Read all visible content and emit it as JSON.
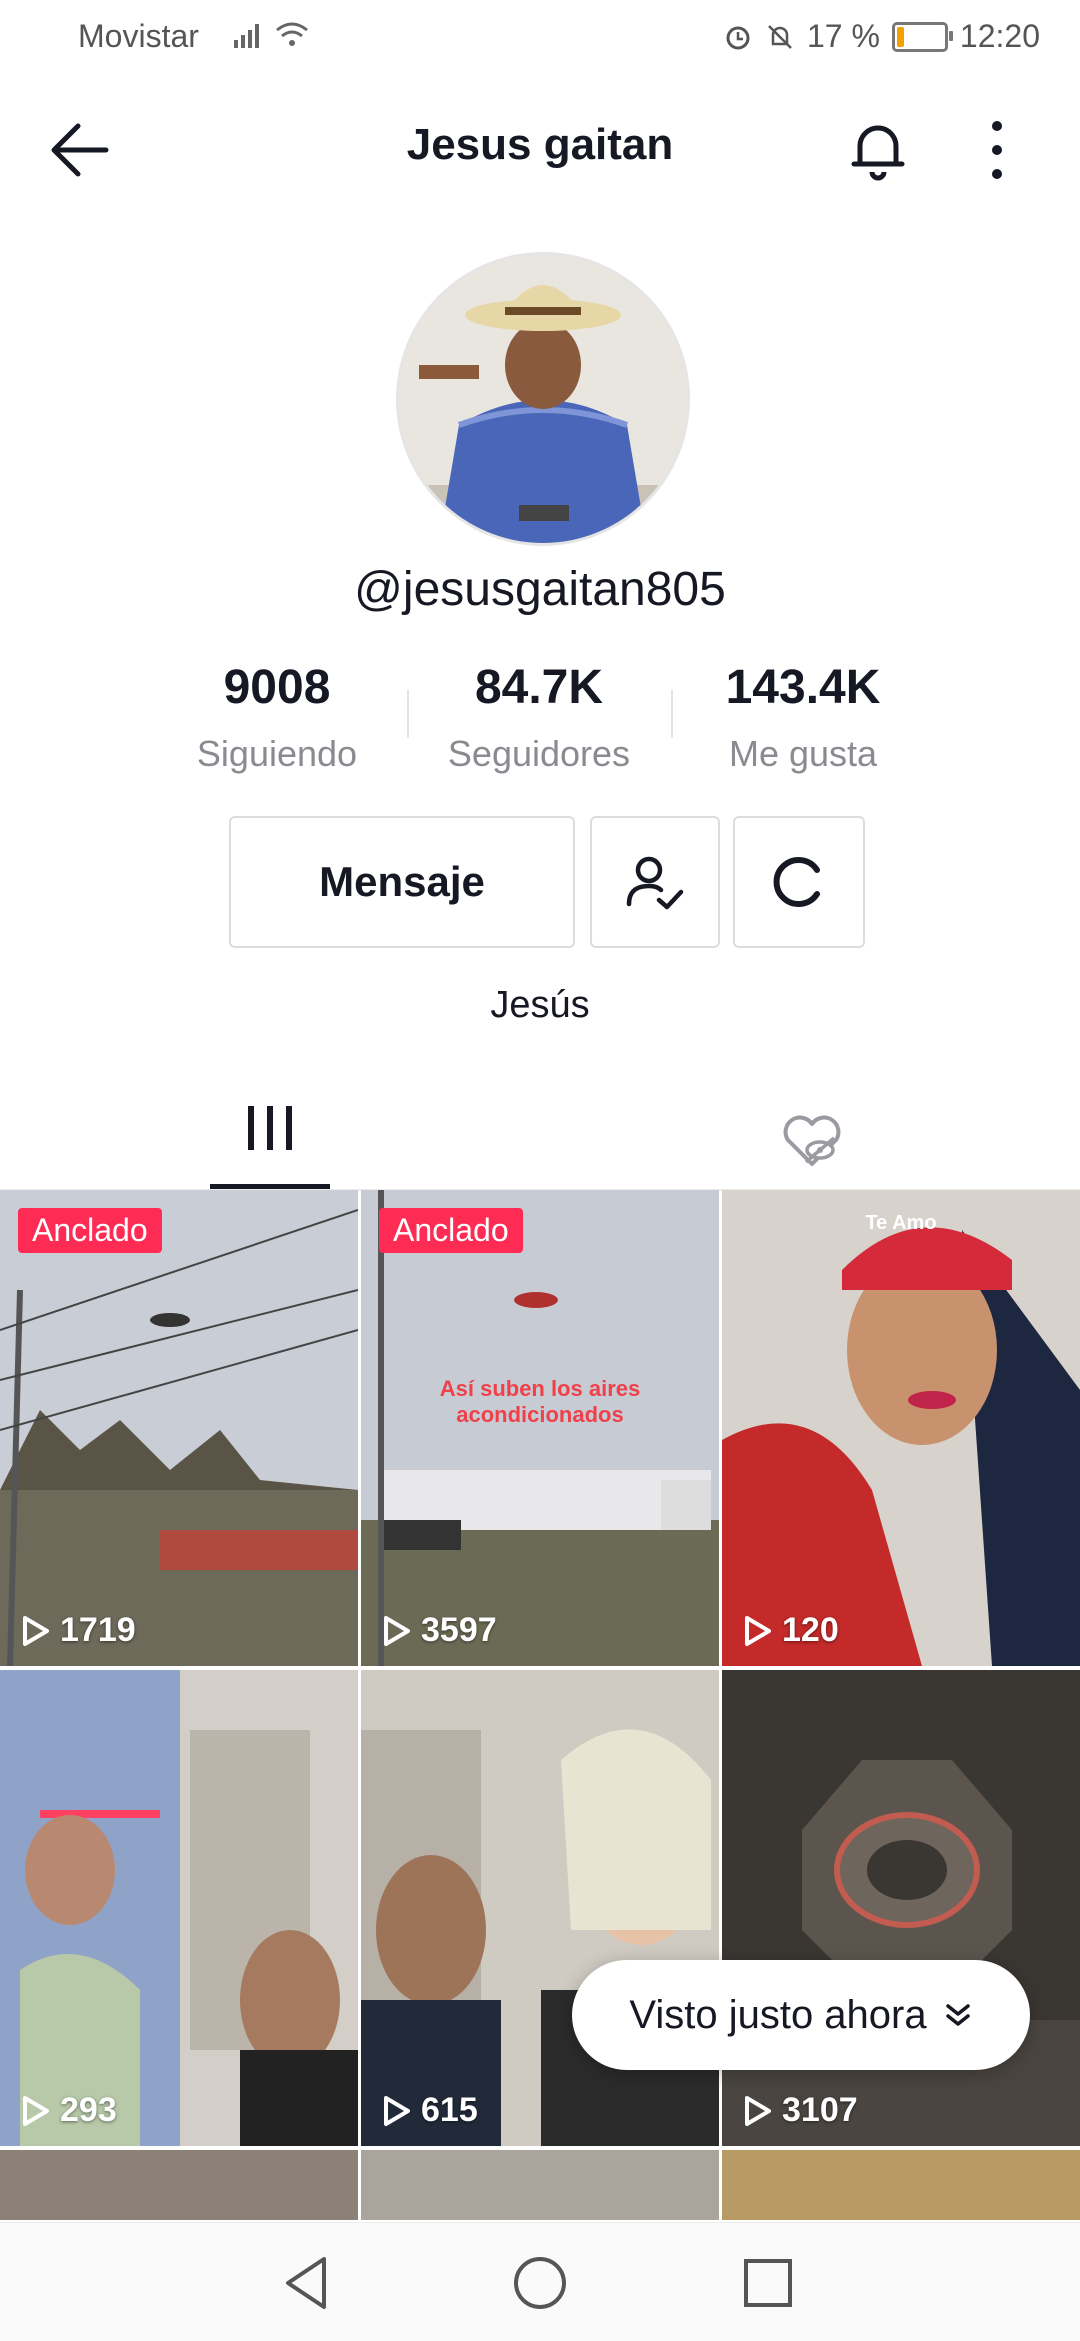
{
  "status_bar": {
    "carrier": "Movistar",
    "battery": "17 %",
    "battery_level": 0.17,
    "time": "12:20"
  },
  "header": {
    "title": "Jesus gaitan"
  },
  "profile": {
    "username": "@jesusgaitan805",
    "stats": [
      {
        "value": "9008",
        "label": "Siguiendo"
      },
      {
        "value": "84.7K",
        "label": "Seguidores"
      },
      {
        "value": "143.4K",
        "label": "Me gusta"
      }
    ],
    "message_label": "Mensaje",
    "bio": "Jesús"
  },
  "videos": [
    {
      "views": "1719",
      "pinned": "Anclado"
    },
    {
      "views": "3597",
      "pinned": "Anclado",
      "caption": "Así suben los aires acondicionados"
    },
    {
      "views": "120",
      "caption": "Te Amo"
    },
    {
      "views": "293"
    },
    {
      "views": "615"
    },
    {
      "views": "3107"
    }
  ],
  "seen_pill": "Visto justo ahora",
  "colors": {
    "accent": "#fe2c55",
    "text": "#161823",
    "muted": "#8a8b91"
  }
}
